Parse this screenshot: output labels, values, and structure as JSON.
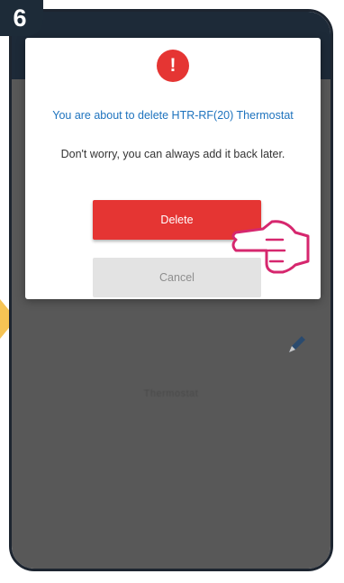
{
  "step": {
    "number": "6"
  },
  "dialog": {
    "icon": "exclamation-icon",
    "icon_glyph": "!",
    "title": "You are about to delete HTR-RF(20) Thermostat",
    "message": "Don't worry, you can always add it back later.",
    "delete_label": "Delete",
    "cancel_label": "Cancel"
  },
  "background": {
    "caption": "Thermostat",
    "edit_icon": "pencil-icon"
  },
  "pointer": {
    "icon": "hand-pointer-icon"
  },
  "colors": {
    "accent": "#e53533",
    "title_text": "#1e73be",
    "header": "#1d2a38",
    "arrow": "#f6c454",
    "hand_outline": "#d6276e"
  }
}
